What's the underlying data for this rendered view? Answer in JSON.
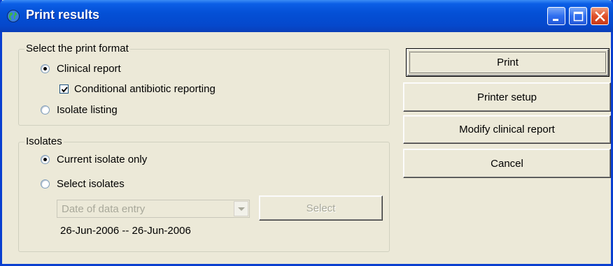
{
  "window": {
    "title": "Print results",
    "icon": "globe-icon"
  },
  "controls": [
    "minimize-icon",
    "maximize-icon",
    "close-icon"
  ],
  "print_format": {
    "legend": "Select the print format",
    "clinical_report": {
      "label": "Clinical report",
      "selected": true
    },
    "conditional_antibiotic": {
      "label": "Conditional antibiotic reporting",
      "checked": true
    },
    "isolate_listing": {
      "label": "Isolate listing",
      "selected": false
    }
  },
  "isolates": {
    "legend": "Isolates",
    "current_only": {
      "label": "Current isolate only",
      "selected": true
    },
    "select_isolates": {
      "label": "Select isolates",
      "selected": false
    },
    "filter_select": {
      "value": "Date of data entry",
      "enabled": false
    },
    "select_button": "Select",
    "date_range": "26-Jun-2006 -- 26-Jun-2006"
  },
  "buttons": {
    "print": "Print",
    "printer_setup": "Printer setup",
    "modify_clinical_report": "Modify clinical report",
    "cancel": "Cancel"
  }
}
